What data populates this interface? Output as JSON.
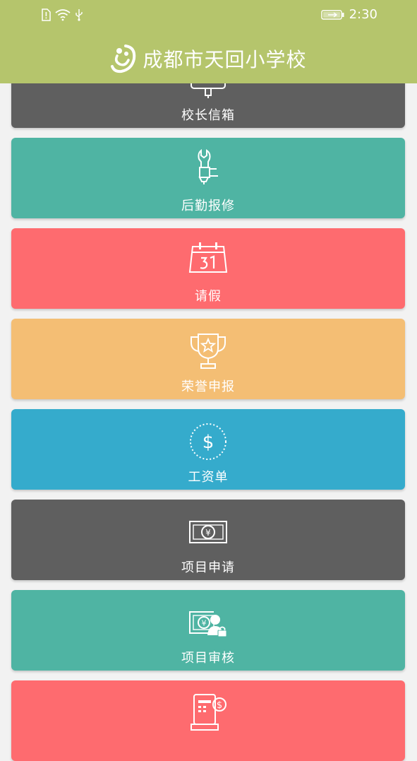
{
  "status_bar": {
    "time": "2:30"
  },
  "header": {
    "title": "成都市天回小学校"
  },
  "colors": {
    "header": "#b5c56c",
    "gray": "#5f5f5f",
    "teal": "#4fb4a3",
    "red": "#fe6b6f",
    "orange": "#f4be74",
    "blue": "#35abcc"
  },
  "menu": [
    {
      "label": "校长信箱",
      "icon": "mailbox-icon"
    },
    {
      "label": "后勤报修",
      "icon": "repair-wrench-icon"
    },
    {
      "label": "请假",
      "icon": "calendar-icon"
    },
    {
      "label": "荣誉申报",
      "icon": "trophy-icon"
    },
    {
      "label": "工资单",
      "icon": "dollar-coin-icon"
    },
    {
      "label": "项目申请",
      "icon": "yen-banknote-icon"
    },
    {
      "label": "项目审核",
      "icon": "banknote-user-lock-icon"
    },
    {
      "label": "",
      "icon": "register-dollar-icon"
    }
  ]
}
